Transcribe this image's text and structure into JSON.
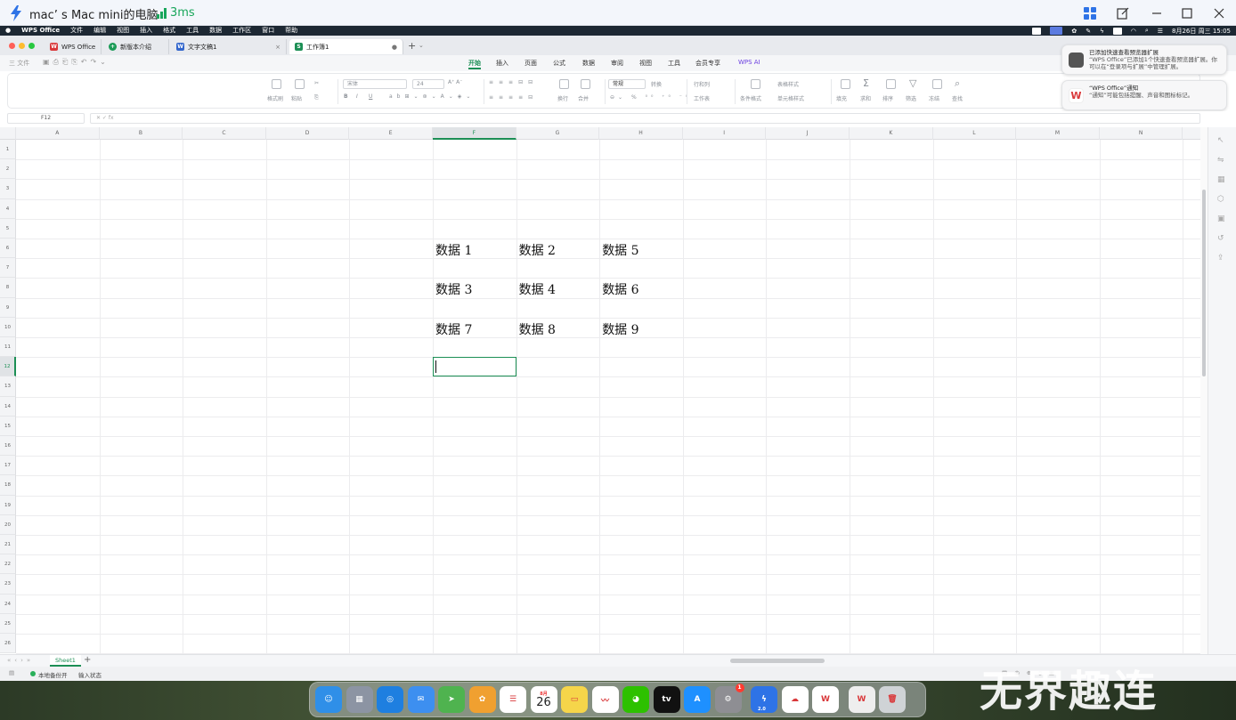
{
  "remote": {
    "title": "mac’ s Mac mini的电脑",
    "latency": "3ms"
  },
  "menubar": {
    "app": "WPS Office",
    "items": [
      "文件",
      "编辑",
      "视图",
      "插入",
      "格式",
      "工具",
      "数据",
      "工作区",
      "窗口",
      "帮助"
    ],
    "clock": "8月26日 周三 15:05"
  },
  "doc_tabs": [
    {
      "label": "WPS Office",
      "color": "#d9383a",
      "glyph": "W"
    },
    {
      "label": "新版本介绍",
      "color": "#1c9b57",
      "glyph": "+"
    },
    {
      "label": "文字文稿1",
      "color": "#3366cc",
      "glyph": "W"
    },
    {
      "label": "工作簿1",
      "color": "#1c8f55",
      "glyph": "S",
      "active": true
    }
  ],
  "file_menu": "三 文件",
  "ribbon_tabs": [
    "开始",
    "插入",
    "页面",
    "公式",
    "数据",
    "审阅",
    "视图",
    "工具",
    "会员专享",
    "WPS AI"
  ],
  "ribbon": {
    "format_painter": "格式刷",
    "paste": "粘贴",
    "font": "宋体",
    "size": "24",
    "bold": "B",
    "italic": "I",
    "underline": "U",
    "wrap": "换行",
    "merge": "合并",
    "number_format": "常规",
    "convert": "转换",
    "rows_cols": "行和列",
    "worksheet": "工作表",
    "cond_format": "条件格式",
    "table_style": "表格样式",
    "cell_style": "单元格样式",
    "fill": "填充",
    "sum": "求和",
    "sort": "排序",
    "filter": "筛选",
    "freeze": "冻结",
    "find": "查找"
  },
  "notifications": [
    {
      "title": "已添加快速查看预览器扩展",
      "body": "“WPS Office”已添加1个快速查看预览器扩展。你可以在“登录项与扩展”中管理扩展。"
    },
    {
      "title": "“WPS Office”通知",
      "body": "“通知”可能包括提醒、声音和图标标记。"
    }
  ],
  "formula_bar": {
    "name_box": "F12",
    "fx": "fx"
  },
  "columns": [
    "A",
    "B",
    "C",
    "D",
    "E",
    "F",
    "G",
    "H",
    "I",
    "J",
    "K",
    "L",
    "M",
    "N"
  ],
  "rows": [
    "1",
    "2",
    "3",
    "4",
    "5",
    "6",
    "7",
    "8",
    "9",
    "10",
    "11",
    "12",
    "13",
    "14",
    "15",
    "16",
    "17",
    "18",
    "19",
    "20",
    "21",
    "22",
    "23",
    "24",
    "25",
    "26"
  ],
  "selected_cell": "F12",
  "cells": [
    {
      "ref": "F6",
      "text": "数据 1"
    },
    {
      "ref": "G6",
      "text": "数据 2"
    },
    {
      "ref": "H6",
      "text": "数据 5"
    },
    {
      "ref": "F8",
      "text": "数据 3"
    },
    {
      "ref": "G8",
      "text": "数据 4"
    },
    {
      "ref": "H8",
      "text": "数据 6"
    },
    {
      "ref": "F10",
      "text": "数据 7"
    },
    {
      "ref": "G10",
      "text": "数据 8"
    },
    {
      "ref": "H10",
      "text": "数据 9"
    }
  ],
  "sheet_tab": "Sheet1",
  "status": {
    "backup": "本地备份开",
    "input": "输入状态"
  },
  "dock_apps": [
    {
      "name": "finder",
      "color": "#2f8fe8",
      "glyph": "☺"
    },
    {
      "name": "launchpad",
      "color": "#8c94a3",
      "glyph": "▦"
    },
    {
      "name": "safari",
      "color": "#1e7fe0",
      "glyph": "◎"
    },
    {
      "name": "mail",
      "color": "#3d8ff0",
      "glyph": "✉"
    },
    {
      "name": "maps",
      "color": "#4fb34f",
      "glyph": "➤"
    },
    {
      "name": "photos",
      "color": "#f0a030",
      "glyph": "✿"
    },
    {
      "name": "reminders",
      "color": "#ffffff",
      "glyph": "☰"
    },
    {
      "name": "calendar",
      "color": "#ffffff",
      "glyph": "26"
    },
    {
      "name": "notes",
      "color": "#f6d54a",
      "glyph": "▭"
    },
    {
      "name": "freeform",
      "color": "#ffffff",
      "glyph": "〰"
    },
    {
      "name": "wechat",
      "color": "#2dc100",
      "glyph": "◕"
    },
    {
      "name": "appletv",
      "color": "#111111",
      "glyph": "tv"
    },
    {
      "name": "appstore",
      "color": "#1e90ff",
      "glyph": "A"
    },
    {
      "name": "settings",
      "color": "#8e8e93",
      "glyph": "⚙"
    },
    {
      "name": "remote-desktop",
      "color": "#2e73e6",
      "glyph": "ϟ"
    },
    {
      "name": "baidu-netdisk",
      "color": "#ffffff",
      "glyph": "☁"
    },
    {
      "name": "wps",
      "color": "#ffffff",
      "glyph": "W"
    },
    {
      "name": "wps-doc",
      "color": "#eeeeee",
      "glyph": "W"
    },
    {
      "name": "trash",
      "color": "#cfd3d6",
      "glyph": "🗑"
    }
  ],
  "calendar_month": "8月",
  "settings_badge": "1",
  "remote_badge": "2.0",
  "watermark": "无界趣连"
}
